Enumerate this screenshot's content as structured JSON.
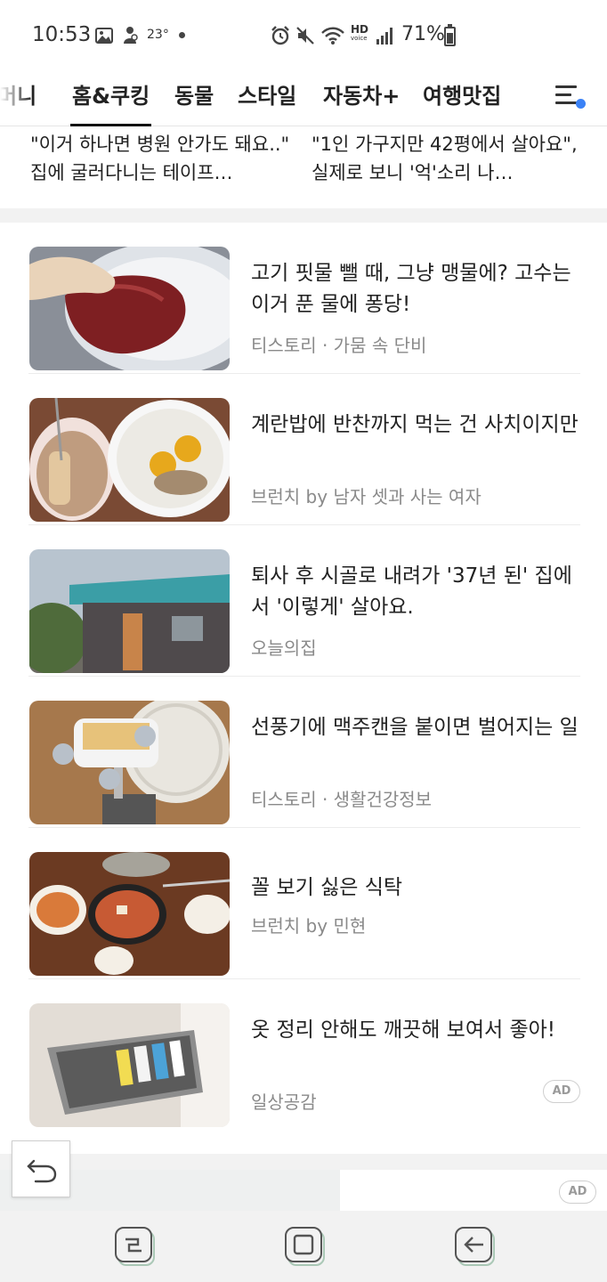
{
  "status_bar": {
    "time": "10:53",
    "temperature": "23°",
    "network_hd": "HD",
    "network_voice": "voice",
    "battery": "71%"
  },
  "tabs": [
    {
      "label": "머니",
      "active": false
    },
    {
      "label": "홈&쿠킹",
      "active": true
    },
    {
      "label": "동물",
      "active": false
    },
    {
      "label": "스타일",
      "active": false
    },
    {
      "label": "자동차+",
      "active": false
    },
    {
      "label": "여행맛집",
      "active": false
    }
  ],
  "top_stories": [
    {
      "title": "\"이거 하나면 병원 안가도 돼요..\" 집에 굴러다니는 테이프…"
    },
    {
      "title": "\"1인 가구지만 42평에서 살아요\", 실제로 보니 '억'소리 나…"
    }
  ],
  "articles": [
    {
      "title": "고기 핏물 뺄 때, 그냥 맹물에? 고수는 이거 푼 물에 퐁당!",
      "source": "티스토리 · 가뭄 속 단비",
      "ad": false
    },
    {
      "title": "계란밥에 반찬까지 먹는 건 사치이지만",
      "source": "브런치 by 남자 셋과 사는 여자",
      "ad": false
    },
    {
      "title": "퇴사 후 시골로 내려가 '37년 된' 집에서 '이렇게' 살아요.",
      "source": "오늘의집",
      "ad": false
    },
    {
      "title": "선풍기에 맥주캔을 붙이면 벌어지는 일",
      "source": "티스토리 · 생활건강정보",
      "ad": false
    },
    {
      "title": "꼴 보기 싫은 식탁",
      "source": "브런치 by 민현",
      "ad": false
    },
    {
      "title": "옷 정리 안해도 깨끗해 보여서 좋아!",
      "source": "일상공감",
      "ad": true,
      "ad_label": "AD"
    }
  ],
  "bottom_ad": {
    "ad_label": "AD"
  },
  "colors": {
    "accent_dot": "#3b82f6",
    "divider": "#f2f2f2",
    "source_text": "#8a8a8a"
  },
  "icons": [
    "gallery-icon",
    "person-notification-icon",
    "alarm-icon",
    "mute-icon",
    "wifi-icon",
    "signal-icon",
    "battery-icon",
    "menu-list-icon",
    "back-arrow-icon",
    "recents-icon",
    "home-icon",
    "nav-back-icon"
  ]
}
